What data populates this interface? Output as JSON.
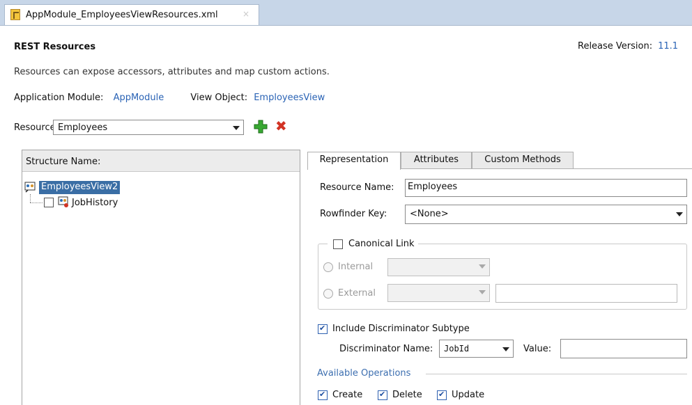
{
  "editor_tab": {
    "label": "AppModule_EmployeesViewResources.xml",
    "close": "×",
    "icon": "xml-file-icon"
  },
  "header": {
    "title": "REST Resources",
    "release_label": "Release Version:",
    "release_value": "11.1",
    "description": "Resources can expose accessors, attributes and map custom actions."
  },
  "context": {
    "app_module_label": "Application Module:",
    "app_module_value": "AppModule",
    "view_object_label": "View Object:",
    "view_object_value": "EmployeesView"
  },
  "resource": {
    "label": "Resource:",
    "value": "Employees",
    "add_icon": "add-icon",
    "delete_icon": "delete-icon"
  },
  "structure": {
    "header": "Structure Name:",
    "root": "EmployeesView2",
    "children": [
      {
        "label": "JobHistory",
        "checked": false
      }
    ]
  },
  "tabs": [
    {
      "label": "Representation",
      "active": true
    },
    {
      "label": "Attributes",
      "active": false
    },
    {
      "label": "Custom Methods",
      "active": false
    }
  ],
  "representation": {
    "resource_name_label": "Resource Name:",
    "resource_name_value": "Employees",
    "rowfinder_label": "Rowfinder Key:",
    "rowfinder_value": "<None>",
    "canonical_link": {
      "label": "Canonical Link",
      "checked": false,
      "internal_label": "Internal",
      "external_label": "External"
    },
    "discriminator": {
      "include_label": "Include Discriminator Subtype",
      "checked": true,
      "name_label": "Discriminator Name:",
      "name_value": "JobId",
      "value_label": "Value:",
      "value_value": ""
    },
    "operations": {
      "header": "Available Operations",
      "items": [
        {
          "label": "Create",
          "checked": true
        },
        {
          "label": "Delete",
          "checked": true
        },
        {
          "label": "Update",
          "checked": true
        }
      ]
    }
  },
  "colors": {
    "link": "#2a63b5",
    "selection": "#3a6ea5",
    "tabstrip": "#c7d6e8",
    "group_header": "#3d6fb0"
  }
}
